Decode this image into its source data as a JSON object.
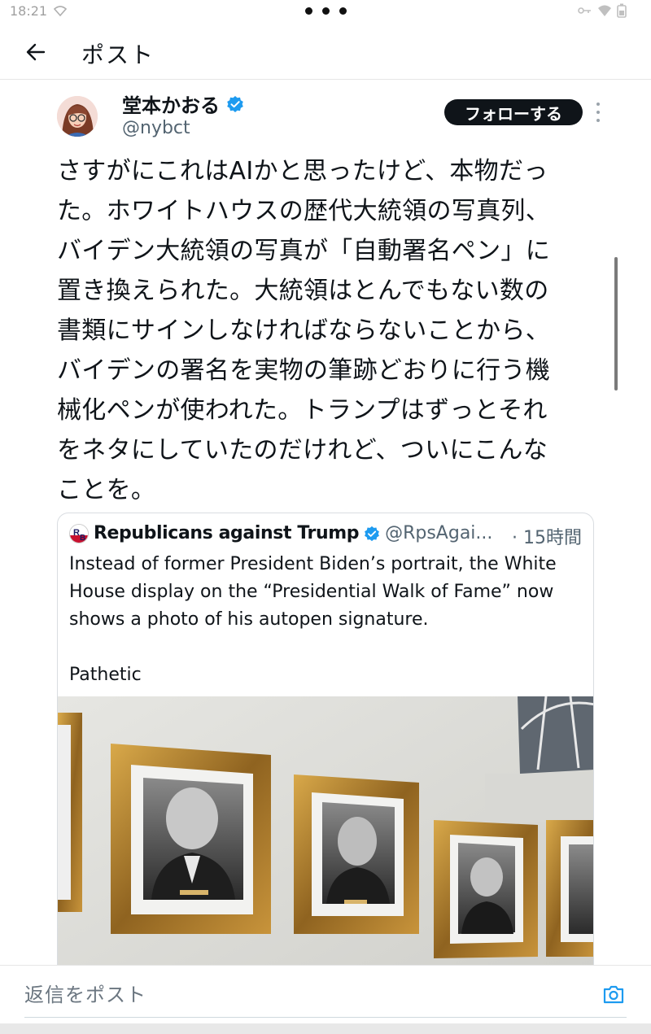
{
  "status_bar": {
    "time": "18:21"
  },
  "header": {
    "title": "ポスト"
  },
  "tweet": {
    "author_name": "堂本かおる",
    "author_handle": "@nybct",
    "follow_label": "フォローする",
    "text": "さすがにこれはAIかと思ったけど、本物だっ\nた。ホワイトハウスの歴代大統領の写真列、\nバイデン大統領の写真が「自動署名ペン」に\n置き換えられた。大統領はとんでもない数の\n書類にサインしなければならないことから、\nバイデンの署名を実物の筆跡どおりに行う機\n械化ペンが使われた。トランプはずっとそれ\nをネタにしていたのだけれど、ついにこんな\nことを。"
  },
  "quote": {
    "author_name": "Republicans against Trump",
    "author_handle": "@RpsAgai...",
    "time": "· 15時間",
    "text": "Instead of former President Biden’s portrait, the White\nHouse display on the “Presidential Walk of Fame” now\nshows a photo of his autopen signature.\n\nPathetic"
  },
  "reply": {
    "placeholder": "返信をポスト"
  },
  "colors": {
    "verified": "#1d9bf0",
    "text": "#0f1419",
    "secondary": "#536471",
    "frame_gold": "#b8892e"
  }
}
